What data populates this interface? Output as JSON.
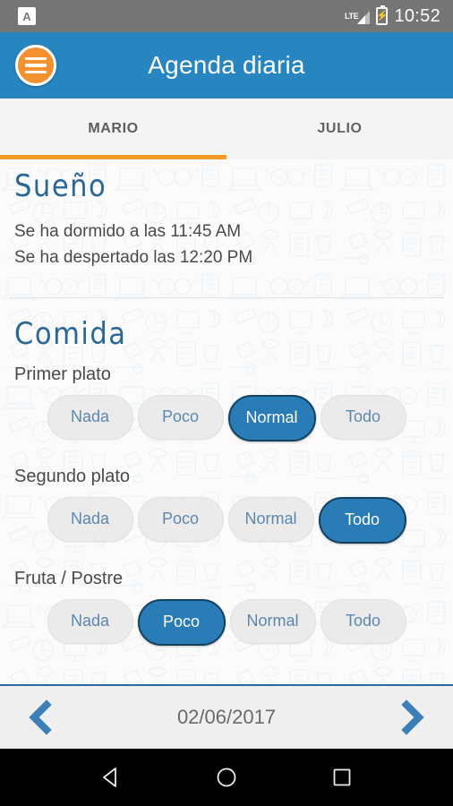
{
  "statusbar": {
    "app_badge": "A",
    "network": "LTE",
    "time": "10:52",
    "battery_icon": "battery-charging-icon"
  },
  "appbar": {
    "title": "Agenda diaria",
    "menu_icon": "hamburger-menu-icon",
    "bg_color": "#2786c0",
    "menu_color": "#f39030"
  },
  "tabs": [
    {
      "label": "MARIO",
      "active": true
    },
    {
      "label": "JULIO",
      "active": false
    }
  ],
  "tab_indicator_color": "#f59a23",
  "sections": {
    "sleep": {
      "title": "Sueño",
      "lines": [
        "Se ha dormido a las 11:45 AM",
        "Se ha despertado las 12:20 PM"
      ]
    },
    "food": {
      "title": "Comida",
      "fields": [
        {
          "label": "Primer plato",
          "options": [
            "Nada",
            "Poco",
            "Normal",
            "Todo"
          ],
          "selected": "Normal"
        },
        {
          "label": "Segundo plato",
          "options": [
            "Nada",
            "Poco",
            "Normal",
            "Todo"
          ],
          "selected": "Todo"
        },
        {
          "label": "Fruta / Postre",
          "options": [
            "Nada",
            "Poco",
            "Normal",
            "Todo"
          ],
          "selected": "Poco"
        }
      ]
    }
  },
  "datebar": {
    "prev_icon": "chevron-left-icon",
    "next_icon": "chevron-right-icon",
    "date": "02/06/2017",
    "arrow_color": "#3c7fb8"
  },
  "navbar": {
    "back_icon": "triangle-back-icon",
    "home_icon": "circle-home-icon",
    "recents_icon": "square-recents-icon"
  },
  "colors": {
    "selected_pill_bg": "#2a7cb7",
    "selected_pill_border": "#13415f",
    "pill_bg": "#ebebeb",
    "pill_text": "#5d87ad",
    "heading": "#2b6795"
  }
}
